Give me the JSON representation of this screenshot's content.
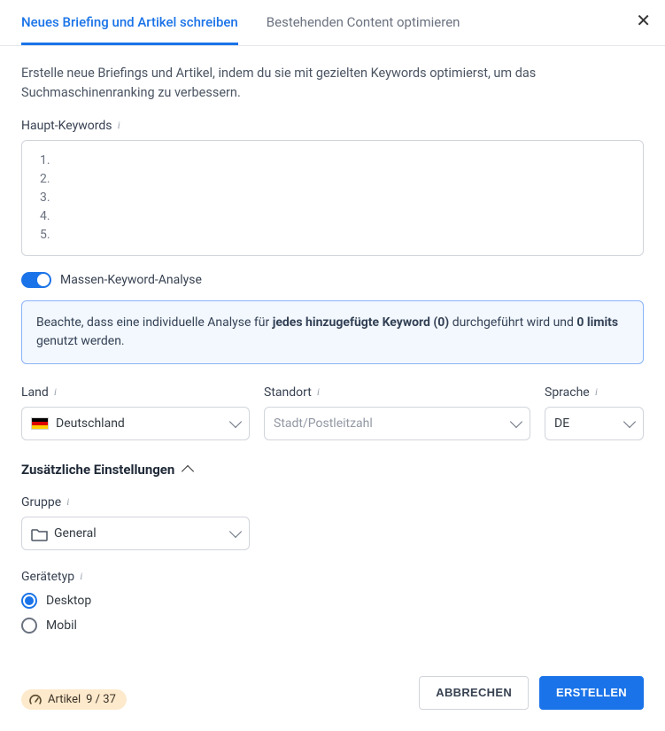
{
  "tabs": {
    "active": "Neues Briefing und Artikel schreiben",
    "inactive": "Bestehenden Content optimieren"
  },
  "description": "Erstelle neue Briefings und Artikel, indem du sie mit gezielten Keywords optimierst, um das Suchmaschinenranking zu verbessern.",
  "keywords": {
    "label": "Haupt-Keywords",
    "lines": [
      "1.",
      "2.",
      "3.",
      "4.",
      "5."
    ]
  },
  "mass_analysis": {
    "label": "Massen-Keyword-Analyse",
    "notice_prefix": "Beachte, dass eine individuelle Analyse für ",
    "notice_bold1": "jedes hinzugefügte Keyword (0)",
    "notice_mid": " durchgeführt wird und ",
    "notice_bold2": "0 limits",
    "notice_suffix": " genutzt werden."
  },
  "country": {
    "label": "Land",
    "value": "Deutschland"
  },
  "standort": {
    "label": "Standort",
    "placeholder": "Stadt/Postleitzahl"
  },
  "language": {
    "label": "Sprache",
    "value": "DE"
  },
  "additional": {
    "header": "Zusätzliche Einstellungen"
  },
  "group": {
    "label": "Gruppe",
    "value": "General"
  },
  "device": {
    "label": "Gerätetyp",
    "desktop": "Desktop",
    "mobile": "Mobil"
  },
  "footer": {
    "badge_label": "Artikel",
    "badge_count": "9 / 37",
    "cancel": "ABBRECHEN",
    "create": "ERSTELLEN"
  }
}
